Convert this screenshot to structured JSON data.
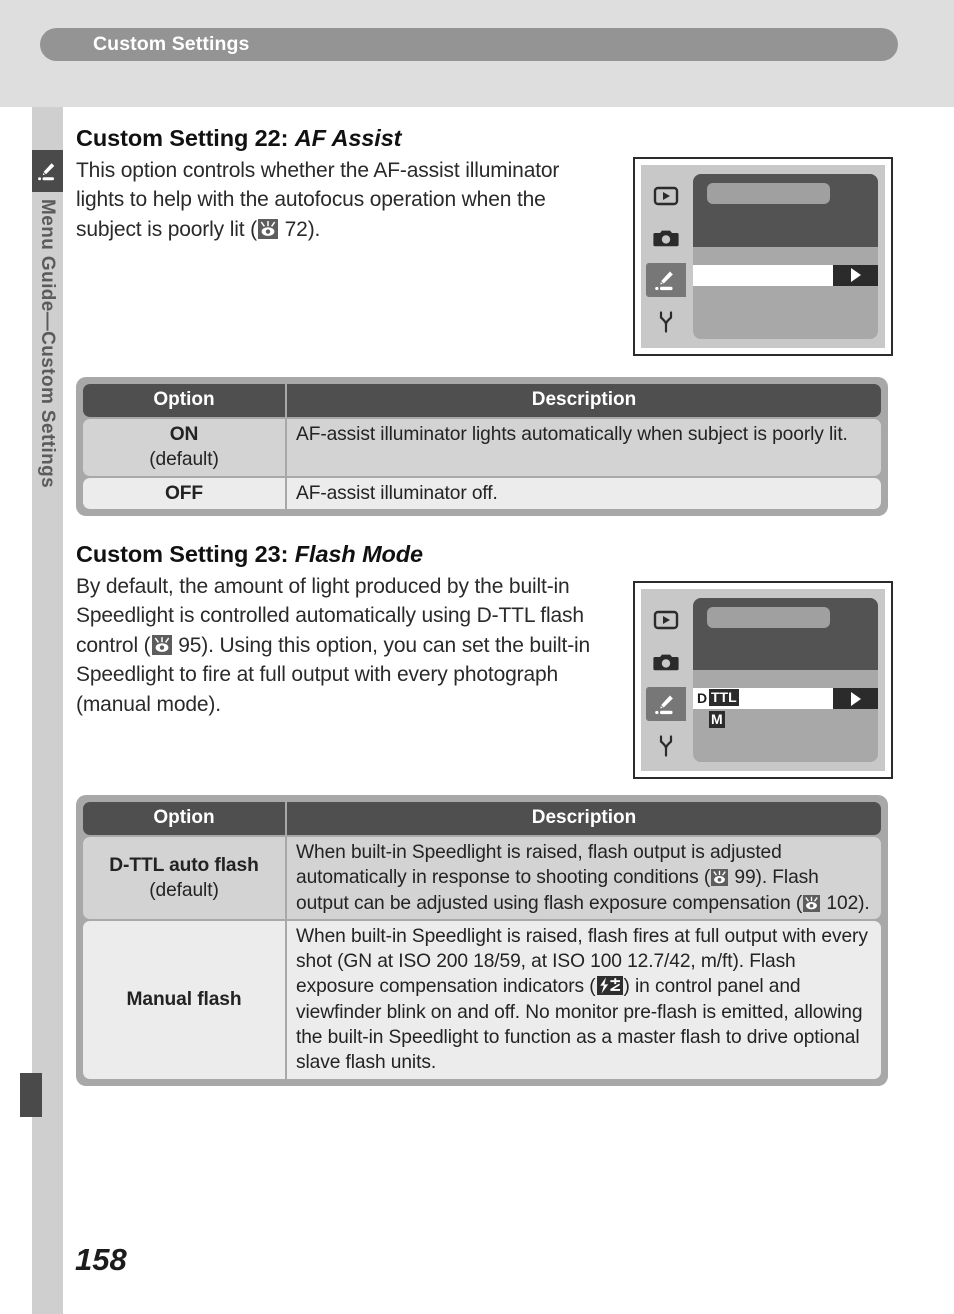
{
  "header": {
    "chapter_title": "Custom Settings"
  },
  "sidebar": {
    "vertical_label": "Menu Guide—Custom Settings",
    "tab_icon": "pencil-icon"
  },
  "sections": [
    {
      "id": "cs22",
      "title_prefix": "Custom Setting 22: ",
      "title_italic": "AF Assist",
      "body_part1": "This option controls whether the AF-assist illuminator lights to help with the autofocus operation when the subject is poorly lit (",
      "body_ref_page": " 72).",
      "body_part2": "",
      "lcd": {
        "tabs": [
          "playback-icon",
          "camera-icon",
          "pencil-icon",
          "wrench-icon"
        ],
        "active_tab_index": 2,
        "selected_row_value": "",
        "secondary_row_value": "",
        "arrow_glyph": "▶"
      },
      "table": {
        "headers": [
          "Option",
          "Description"
        ],
        "rows": [
          {
            "option": "ON",
            "option_sub": "(default)",
            "description": "AF-assist illuminator lights automatically when subject is poorly lit."
          },
          {
            "option": "OFF",
            "option_sub": "",
            "description": "AF-assist illuminator off."
          }
        ]
      }
    },
    {
      "id": "cs23",
      "title_prefix": "Custom Setting 23: ",
      "title_italic": "Flash Mode",
      "body_part1": "By default, the amount of light produced by the built-in Speedlight is controlled automatically using D-TTL flash control (",
      "body_ref_page": " 95).",
      "body_part2": "  Using this option, you can set the built-in Speedlight to fire at full output with every photograph (manual mode).",
      "lcd": {
        "tabs": [
          "playback-icon",
          "camera-icon",
          "pencil-icon",
          "wrench-icon"
        ],
        "active_tab_index": 2,
        "selected_row_prefix": "D",
        "selected_row_value": "TTL",
        "secondary_row_value": "M",
        "arrow_glyph": "▶"
      },
      "table": {
        "headers": [
          "Option",
          "Description"
        ],
        "rows": [
          {
            "option": "D-TTL auto flash",
            "option_sub": "(default)",
            "desc_p1": "When built-in Speedlight is raised, flash output is adjusted automatically in response to shooting conditions (",
            "desc_ref1": " 99).  Flash output can be adjusted using flash exposure compensation (",
            "desc_ref2": " 102)."
          },
          {
            "option": "Manual flash",
            "option_sub": "",
            "desc_p1": "When built-in Speedlight is raised, flash fires at full output with every shot (GN at ISO 200 18/59, at ISO 100 12.7/42, m/ft). Flash exposure compensation indicators (",
            "desc_ref1": ") in control panel and viewfinder blink on and off.  No monitor pre-flash is emitted, allowing the built-in Speedlight to function as a master flash to drive optional slave flash units.",
            "desc_ref2": ""
          }
        ]
      }
    }
  ],
  "footer": {
    "page_number": "158"
  },
  "colors": {
    "banner_gray": "#949494",
    "band_gray": "#dedede",
    "sidebar_gray": "#cfcfcf",
    "tab_dark": "#4a4a4a",
    "table_header_dark": "#4f4f4f",
    "table_frame": "#a8a8a8",
    "row_dark": "#d3d3d3",
    "row_light": "#ececec"
  }
}
